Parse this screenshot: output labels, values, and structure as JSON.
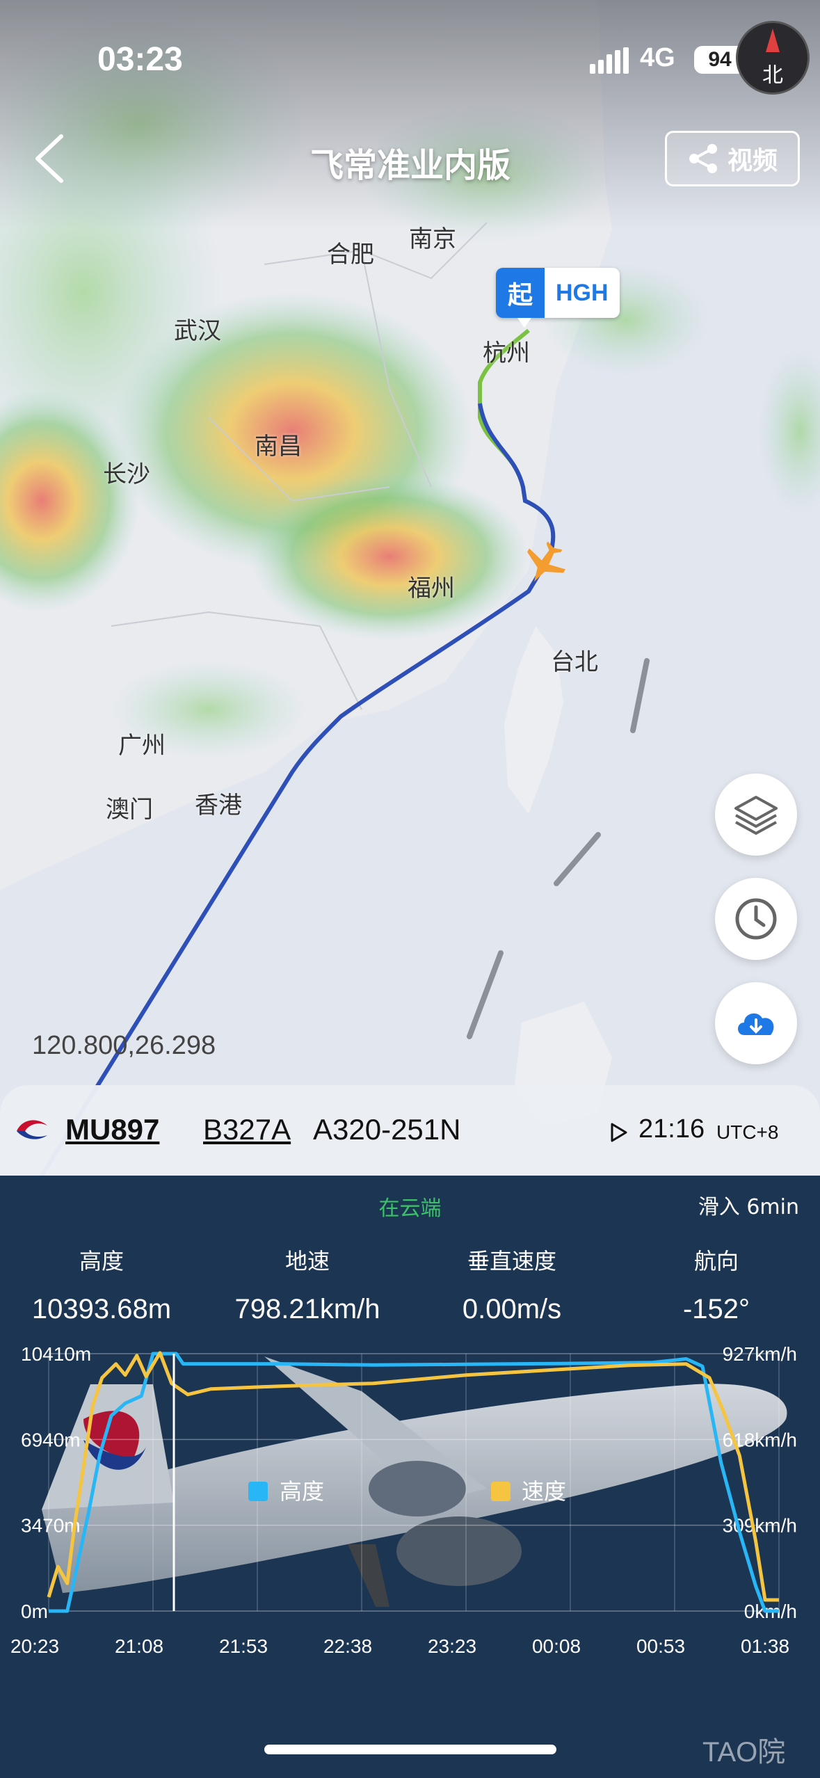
{
  "status_bar": {
    "time": "03:23",
    "network": "4G",
    "battery": "94",
    "compass_label": "北"
  },
  "header": {
    "title": "飞常准业内版",
    "video_button": "视频"
  },
  "map": {
    "cities": [
      "合肥",
      "南京",
      "武汉",
      "杭州",
      "南昌",
      "长沙",
      "福州",
      "台北",
      "广州",
      "澳门",
      "香港"
    ],
    "origin": {
      "tag": "起",
      "code": "HGH"
    },
    "coordinates": "120.800,26.298"
  },
  "flight": {
    "number": "MU897",
    "registration": "B327A",
    "aircraft": "A320-251N",
    "time": "21:16",
    "timezone": "UTC+8"
  },
  "panel": {
    "status": "在云端",
    "taxi_in": "滑入 6min",
    "stats": [
      {
        "label": "高度",
        "value": "10393.68m"
      },
      {
        "label": "地速",
        "value": "798.21km/h"
      },
      {
        "label": "垂直速度",
        "value": "0.00m/s"
      },
      {
        "label": "航向",
        "value": "-152°"
      }
    ]
  },
  "colors": {
    "altitude": "#29b6f6",
    "speed": "#f5c542",
    "route_green": "#7cc242",
    "route_blue": "#2f4fb8",
    "panel_bg": "#1c3553",
    "accent": "#1e78e6"
  },
  "watermark": "TAO院",
  "chart_data": {
    "type": "line",
    "x_ticks": [
      "20:23",
      "21:08",
      "21:53",
      "22:38",
      "23:23",
      "00:08",
      "00:53",
      "01:38"
    ],
    "y_left_ticks": [
      "10410m",
      "6940m",
      "3470m",
      "0m"
    ],
    "y_right_ticks": [
      "927km/h",
      "618km/h",
      "309km/h",
      "0km/h"
    ],
    "y_left_range": [
      0,
      10410
    ],
    "y_right_range": [
      0,
      927
    ],
    "x_range_minutes": [
      0,
      315
    ],
    "cursor_minute": 54,
    "series": [
      {
        "name": "高度",
        "color": "#29b6f6",
        "points": [
          [
            0,
            0
          ],
          [
            8,
            0
          ],
          [
            12,
            1700
          ],
          [
            17,
            3900
          ],
          [
            22,
            6300
          ],
          [
            27,
            7900
          ],
          [
            33,
            8400
          ],
          [
            40,
            8700
          ],
          [
            45,
            10410
          ],
          [
            55,
            10410
          ],
          [
            58,
            10000
          ],
          [
            100,
            10000
          ],
          [
            140,
            9950
          ],
          [
            180,
            9980
          ],
          [
            220,
            10010
          ],
          [
            260,
            10050
          ],
          [
            275,
            10200
          ],
          [
            282,
            9900
          ],
          [
            290,
            6000
          ],
          [
            298,
            3200
          ],
          [
            305,
            1000
          ],
          [
            309,
            0
          ],
          [
            315,
            0
          ]
        ]
      },
      {
        "name": "速度",
        "color": "#f5c542",
        "points": [
          [
            0,
            50
          ],
          [
            4,
            160
          ],
          [
            8,
            100
          ],
          [
            11,
            300
          ],
          [
            15,
            520
          ],
          [
            19,
            740
          ],
          [
            23,
            840
          ],
          [
            29,
            890
          ],
          [
            33,
            850
          ],
          [
            38,
            920
          ],
          [
            42,
            845
          ],
          [
            48,
            930
          ],
          [
            53,
            820
          ],
          [
            60,
            780
          ],
          [
            70,
            800
          ],
          [
            100,
            810
          ],
          [
            140,
            820
          ],
          [
            180,
            850
          ],
          [
            220,
            870
          ],
          [
            250,
            885
          ],
          [
            275,
            890
          ],
          [
            285,
            840
          ],
          [
            291,
            720
          ],
          [
            298,
            560
          ],
          [
            305,
            250
          ],
          [
            309,
            40
          ],
          [
            315,
            40
          ]
        ]
      }
    ]
  }
}
